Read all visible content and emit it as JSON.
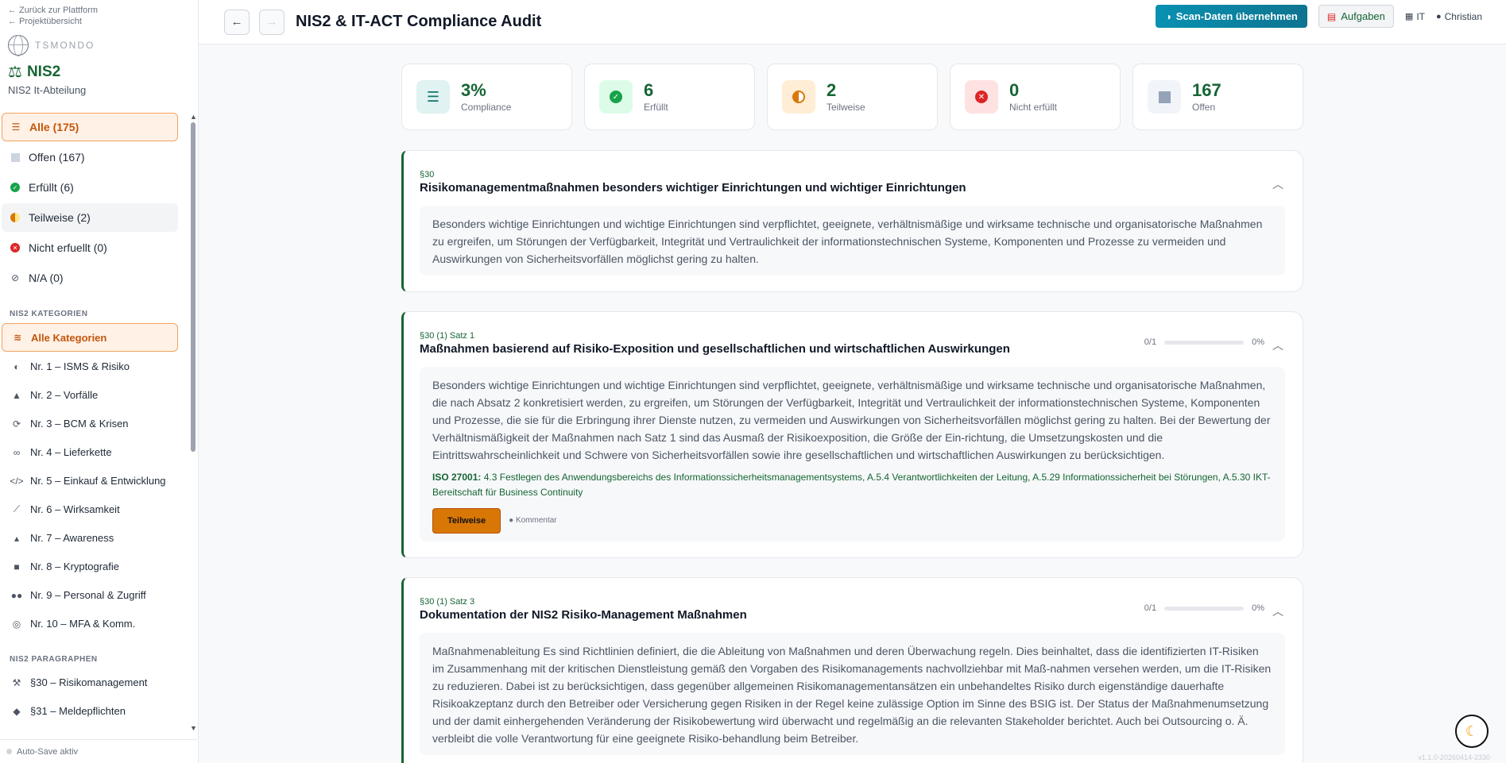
{
  "sidebar": {
    "back_platform": "← Zurück zur Plattform",
    "back_projects": "← Projektübersicht",
    "brand": "TSMONDO",
    "product": "NIS2",
    "product_sub": "NIS2 It-Abteilung",
    "filters": [
      {
        "label": "Alle (175)",
        "icon": "list-icon"
      },
      {
        "label": "Offen (167)",
        "icon": "square-icon"
      },
      {
        "label": "Erfüllt (6)",
        "icon": "check-circle-icon"
      },
      {
        "label": "Teilweise (2)",
        "icon": "half-circle-icon"
      },
      {
        "label": "Nicht erfuellt (0)",
        "icon": "x-circle-icon"
      },
      {
        "label": "N/A (0)",
        "icon": "ban-icon"
      }
    ],
    "categories_label": "NIS2 KATEGORIEN",
    "categories": [
      {
        "label": "Alle Kategorien",
        "icon": "layers-icon"
      },
      {
        "label": "Nr. 1 – ISMS & Risiko",
        "icon": "shield-icon"
      },
      {
        "label": "Nr. 2 – Vorfälle",
        "icon": "warning-icon"
      },
      {
        "label": "Nr. 3 – BCM & Krisen",
        "icon": "refresh-icon"
      },
      {
        "label": "Nr. 4 – Lieferkette",
        "icon": "link-icon"
      },
      {
        "label": "Nr. 5 – Einkauf & Entwicklung",
        "icon": "code-icon"
      },
      {
        "label": "Nr. 6 – Wirksamkeit",
        "icon": "chart-icon"
      },
      {
        "label": "Nr. 7 – Awareness",
        "icon": "graduation-cap-icon"
      },
      {
        "label": "Nr. 8 – Kryptografie",
        "icon": "lock-icon"
      },
      {
        "label": "Nr. 9 – Personal & Zugriff",
        "icon": "users-icon"
      },
      {
        "label": "Nr. 10 – MFA & Komm.",
        "icon": "fingerprint-icon"
      }
    ],
    "paragraphs_label": "NIS2 PARAGRAPHEN",
    "paragraphs": [
      {
        "label": "§30 – Risikomanagement",
        "icon": "gavel-icon"
      },
      {
        "label": "§31 – Meldepflichten",
        "icon": "bell-icon"
      }
    ],
    "footer": "Auto-Save aktiv"
  },
  "header": {
    "title": "NIS2 & IT-ACT Compliance Audit",
    "scan_button": "Scan-Daten übernehmen",
    "tasks_button": "Aufgaben",
    "department": "IT",
    "user": "Christian"
  },
  "stats": [
    {
      "value": "3%",
      "label": "Compliance",
      "icon": "checklist-icon",
      "bg": "#e0f2f1",
      "color": "#0f766e"
    },
    {
      "value": "6",
      "label": "Erfüllt",
      "icon": "check-circle-icon",
      "bg": "#dcfce7",
      "color": "#16a34a"
    },
    {
      "value": "2",
      "label": "Teilweise",
      "icon": "half-circle-icon",
      "bg": "#ffedd5",
      "color": "#d97706"
    },
    {
      "value": "0",
      "label": "Nicht erfüllt",
      "icon": "x-circle-icon",
      "bg": "#fee2e2",
      "color": "#dc2626"
    },
    {
      "value": "167",
      "label": "Offen",
      "icon": "square-icon",
      "bg": "#f1f5f9",
      "color": "#94a3b8"
    }
  ],
  "cards": [
    {
      "para": "§30",
      "title": "Risikomanagementmaßnahmen besonders wichtiger Einrichtungen und wichtiger Einrichtungen",
      "text": "Besonders wichtige Einrichtungen und wichtige Einrichtungen sind verpflichtet, geeignete, verhältnismäßige und wirksame technische und organisatorische Maßnahmen zu ergreifen, um Störungen der Verfügbarkeit, Integrität und Vertraulichkeit der informationstechnischen Systeme, Komponenten und Prozesse zu vermeiden und Auswirkungen von Sicherheitsvorfällen möglichst gering zu halten."
    },
    {
      "para": "§30 (1) Satz 1",
      "title": "Maßnahmen basierend auf Risiko-Exposition und gesellschaftlichen und wirtschaftlichen Auswirkungen",
      "progress_text": "0/1",
      "progress_pct_text": "0%",
      "progress_fraction": 0,
      "text": "Besonders wichtige Einrichtungen und wichtige Einrichtungen sind verpflichtet, geeignete, verhältnismäßige und wirksame technische und organisatorische Maßnahmen, die nach Absatz 2 konkretisiert werden, zu ergreifen, um Störungen der Verfügbarkeit, Integrität und Vertraulichkeit der informationstechnischen Systeme, Komponenten und Prozesse, die sie für die Erbringung ihrer Dienste nutzen, zu vermeiden und Auswirkungen von Sicherheitsvorfällen möglichst gering zu halten. Bei der Bewertung der Verhältnismäßigkeit der Maßnahmen nach Satz 1 sind das Ausmaß der Risikoexposition, die Größe der Ein-richtung, die Umsetzungskosten und die Eintrittswahrscheinlichkeit und Schwere von Sicherheitsvorfällen sowie ihre gesellschaftlichen und wirtschaftlichen Auswirkungen zu berücksichtigen.",
      "iso_label": "ISO 27001:",
      "iso_text": "4.3 Festlegen des Anwendungsbereichs des Informationssicherheitsmanagementsystems, A.5.4 Verantwortlichkeiten der Leitung, A.5.29 Informationssicherheit bei Störungen, A.5.30 IKT-Bereitschaft für Business Continuity",
      "status": "Teilweise",
      "comment": "Kommentar"
    },
    {
      "para": "§30 (1) Satz 3",
      "title": "Dokumentation der NIS2 Risiko-Management Maßnahmen",
      "progress_text": "0/1",
      "progress_pct_text": "0%",
      "progress_fraction": 0,
      "text": "Maßnahmenableitung Es sind Richtlinien definiert, die die Ableitung von Maßnahmen und deren Überwachung regeln. Dies beinhaltet, dass die identifizierten IT-Risiken im Zusammenhang mit der kritischen Dienstleistung gemäß den Vorgaben des Risikomanagements nachvollziehbar mit Maß-nahmen versehen werden, um die IT-Risiken zu reduzieren. Dabei ist zu berücksichtigen, dass gegenüber allgemeinen Risikomanagementansätzen ein unbehandeltes Risiko durch eigenständige dauerhafte Risikoakzeptanz durch den Betreiber oder Versicherung gegen Risiken in der Regel keine zulässige Option im Sinne des BSIG ist. Der Status der Maßnahmenumsetzung und der damit einhergehenden Veränderung der Risikobewertung wird überwacht und regelmäßig an die relevanten Stakeholder berichtet. Auch bei Outsourcing o. Ä. verbleibt die volle Verantwortung für eine geeignete Risiko-behandlung beim Betreiber."
    }
  ],
  "version": "v1.1.0-20260414-2330"
}
